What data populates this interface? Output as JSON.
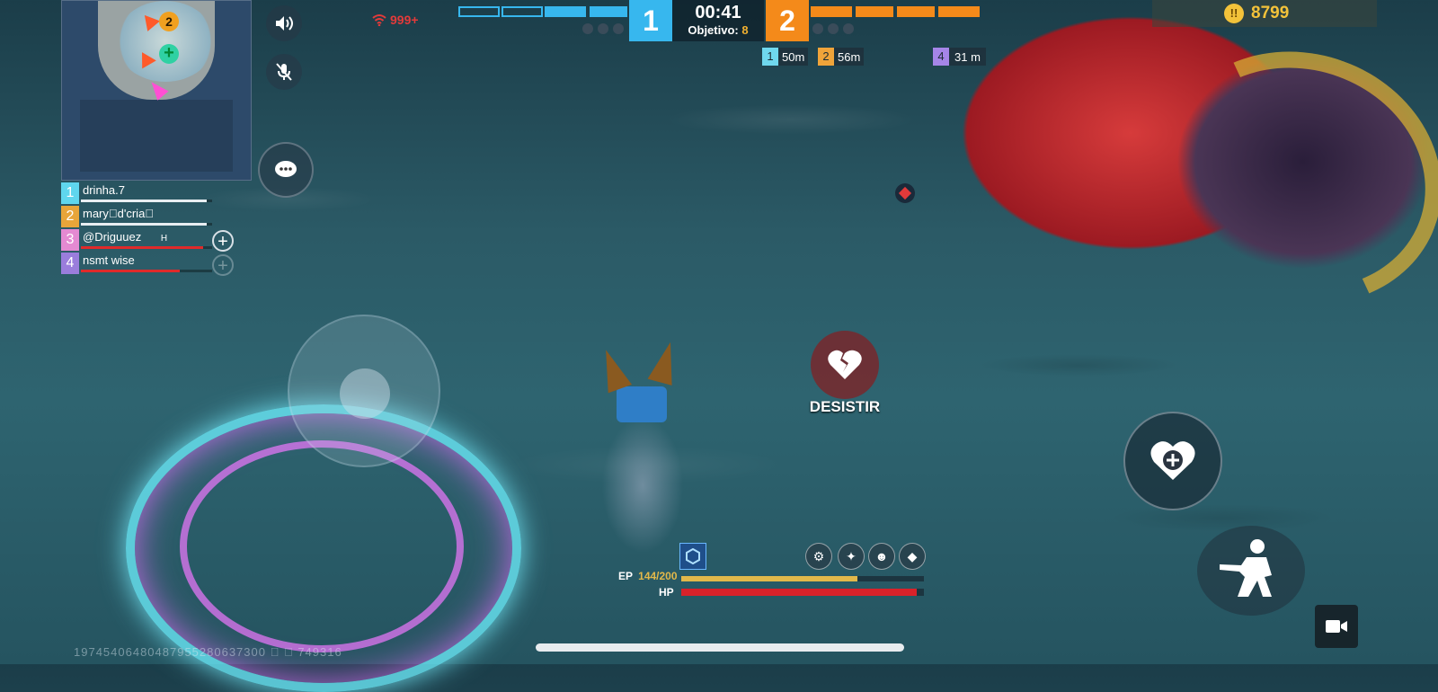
{
  "scoreboard": {
    "team_blue_score": "1",
    "team_orange_score": "2",
    "timer": "00:41",
    "objective_label": "Objetivo:",
    "objective_value": "8",
    "blue_color": "#37b7ee",
    "orange_color": "#f48a1a"
  },
  "network": {
    "ping": "999+",
    "icon": "wifi-signal-icon"
  },
  "coins": {
    "amount": "8799",
    "icon": "coin-icon"
  },
  "distances": [
    {
      "slot": "1",
      "distance": "50m",
      "color": "#6fd8ee"
    },
    {
      "slot": "2",
      "distance": "56m",
      "color": "#f0a43a"
    },
    {
      "slot": "4",
      "distance": "31 m",
      "color": "#a585e8"
    }
  ],
  "minimap": {
    "squad_badge": "2"
  },
  "team": [
    {
      "slot": "1",
      "name": "drinha.7",
      "color": "#5fd6ee",
      "hp_pct": 0.95,
      "hp_color": "#e8eef2"
    },
    {
      "slot": "2",
      "name": "mary\u0000d'cria\u0000",
      "color": "#e8a53a",
      "hp_pct": 0.95,
      "hp_color": "#e8eef2"
    },
    {
      "slot": "3",
      "name": "@Driguuez",
      "suffix": "H",
      "color": "#e48ad2",
      "hp_pct": 0.93,
      "hp_color": "#e02a2a"
    },
    {
      "slot": "4",
      "name": "nsmt   wise",
      "color": "#9a7ddc",
      "hp_pct": 0.75,
      "hp_color": "#e02a2a"
    }
  ],
  "actions": {
    "desistir_label": "DESISTIR",
    "heal_icon": "heart-plus-icon",
    "crouch_icon": "crouch-soldier-icon",
    "record_icon": "video-camera-icon",
    "sound_icon": "speaker-icon",
    "mic_icon": "mic-off-icon",
    "chat_icon": "chat-bubble-icon"
  },
  "stats": {
    "ep_label": "EP",
    "ep_value": "144/200",
    "ep_pct": 0.72,
    "ep_color": "#e2b84a",
    "hp_label": "HP",
    "hp_pct": 0.97,
    "hp_color": "#d8222a"
  },
  "watermark": "19745406480487955280637300 \u0000 \u0000 749316"
}
